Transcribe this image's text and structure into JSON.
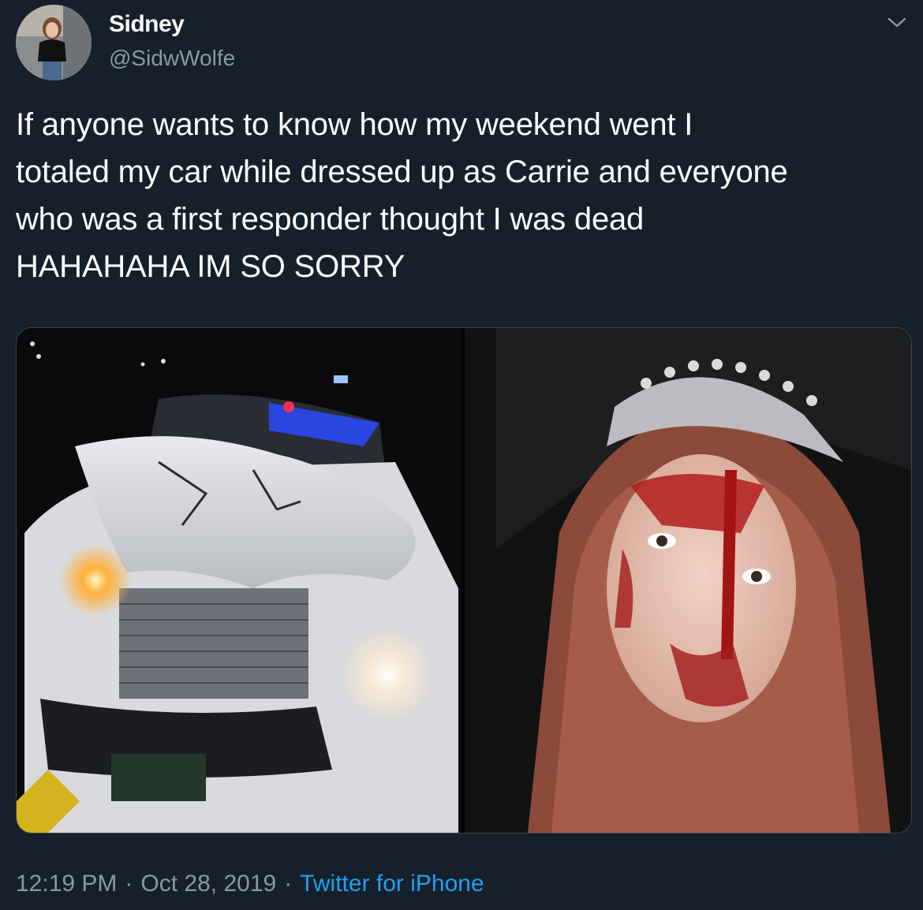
{
  "user": {
    "display_name": "Sidney",
    "handle": "@SidwWolfe"
  },
  "tweet": {
    "text": "If anyone wants to know how my weekend went I\ntotaled my car while dressed up as Carrie and everyone\nwho was a first responder thought I was dead\nHAHAHAHA IM SO SORRY"
  },
  "meta": {
    "time": "12:19 PM",
    "separator": "·",
    "date": "Oct 28, 2019",
    "source": "Twitter for iPhone"
  },
  "icons": {
    "menu": "chevron-down-icon"
  },
  "colors": {
    "background": "#15202b",
    "secondary_text": "#8899a6",
    "link": "#1da1f2",
    "border": "#38444d"
  }
}
